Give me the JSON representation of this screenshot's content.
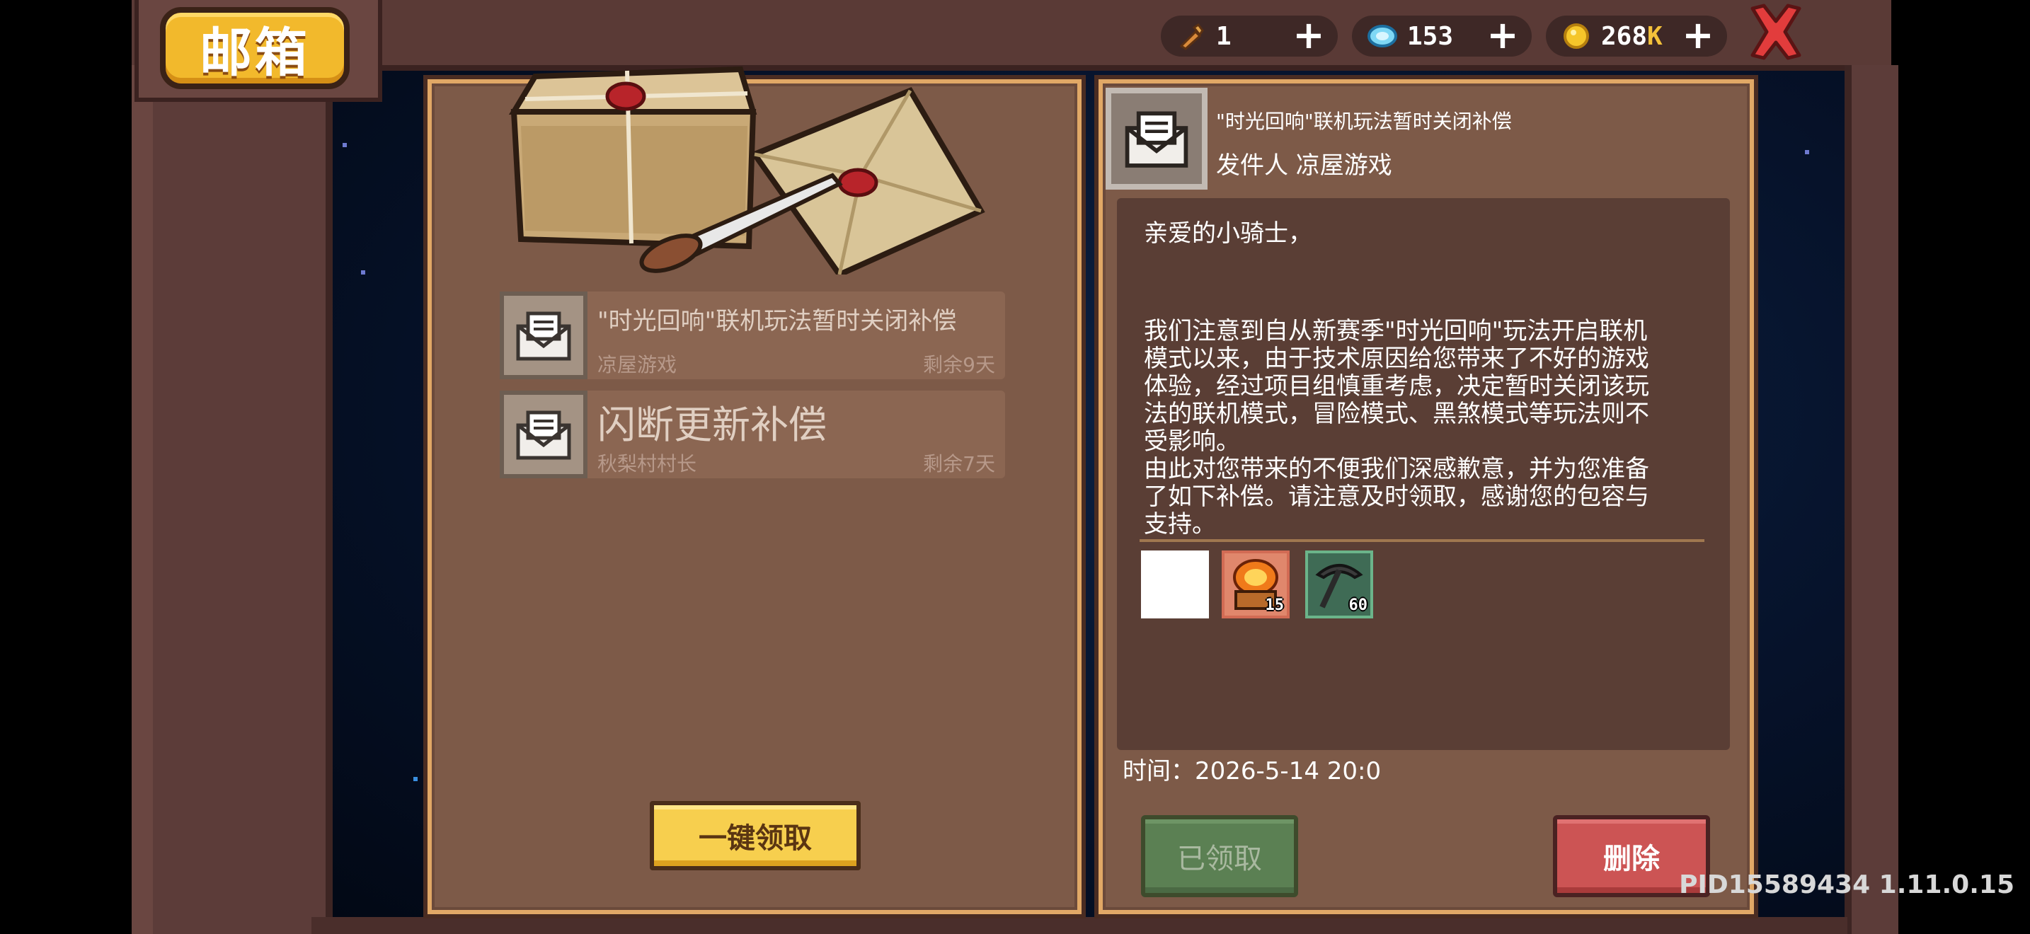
{
  "window": {
    "title": "邮箱"
  },
  "currencies": [
    {
      "name": "material",
      "icon": "carrot-material-icon",
      "value": "1"
    },
    {
      "name": "gems",
      "icon": "blue-gem-icon",
      "value": "153"
    },
    {
      "name": "gold",
      "icon": "gold-coin-icon",
      "value_num": "268",
      "value_suffix": "K"
    }
  ],
  "mail_list": [
    {
      "title": "\"时光回响\"联机玩法暂时关闭补偿",
      "sender": "凉屋游戏",
      "remaining": "剩余9天",
      "icon": "envelope-icon"
    },
    {
      "title": "闪断更新补偿",
      "sender": "秋梨村村长",
      "remaining": "剩余7天",
      "icon": "envelope-icon"
    }
  ],
  "claim_all_label": "一键领取",
  "detail": {
    "title": "\"时光回响\"联机玩法暂时关闭补偿",
    "sender_label": "发件人 凉屋游戏",
    "body_lines": [
      "亲爱的小骑士，",
      "我们注意到自从新赛季\"时光回响\"玩法开启联机",
      "模式以来，由于技术原因给您带来了不好的游戏",
      "体验，经过项目组慎重考虑，决定暂时关闭该玩",
      "法的联机模式，冒险模式、黑煞模式等玩法则不",
      "受影响。",
      "由此对您带来的不便我们深感歉意，并为您准备",
      "了如下补偿。请注意及时领取，感谢您的包容与",
      "支持。"
    ],
    "rewards": [
      {
        "icon": "blank-reward-icon",
        "count": ""
      },
      {
        "icon": "fire-chest-icon",
        "count": "15"
      },
      {
        "icon": "pickaxe-icon",
        "count": "60"
      }
    ],
    "time_label": "时间：2026-5-14 20:0",
    "claimed_label": "已领取",
    "delete_label": "删除"
  },
  "pid_version": "PID15589434 1.11.0.15",
  "colors": {
    "accent_gold": "#f2b92c",
    "panel_bg": "#7d5a48",
    "delete_red": "#cc5454",
    "claimed_green": "#5b8053"
  }
}
